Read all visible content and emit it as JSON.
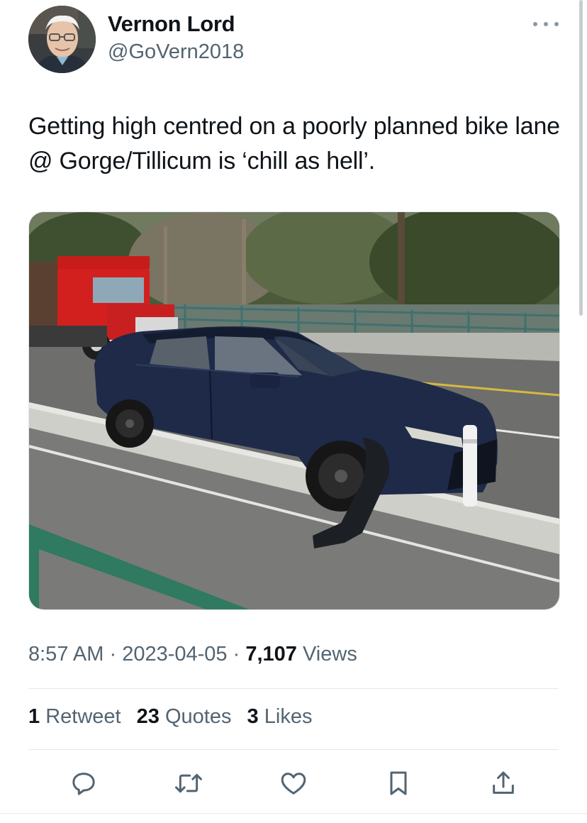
{
  "author": {
    "display_name": "Vernon Lord",
    "handle": "@GoVern2018"
  },
  "tweet": {
    "text": "Getting high centred on a poorly planned bike lane @ Gorge/Tillicum is ‘chill as hell’."
  },
  "meta": {
    "time": "8:57 AM",
    "separator": "·",
    "date": "2023-04-05",
    "views_count": "7,107",
    "views_label": "Views"
  },
  "stats": {
    "retweets_count": "1",
    "retweets_label": "Retweet",
    "quotes_count": "23",
    "quotes_label": "Quotes",
    "likes_count": "3",
    "likes_label": "Likes"
  },
  "icons": {
    "more": "more-icon",
    "reply": "reply-icon",
    "retweet": "retweet-icon",
    "like": "like-icon",
    "bookmark": "bookmark-icon",
    "share": "share-icon"
  },
  "colors": {
    "text": "#0f1419",
    "secondary": "#536471",
    "divider": "#e6e9ec",
    "icon": "#536471"
  }
}
